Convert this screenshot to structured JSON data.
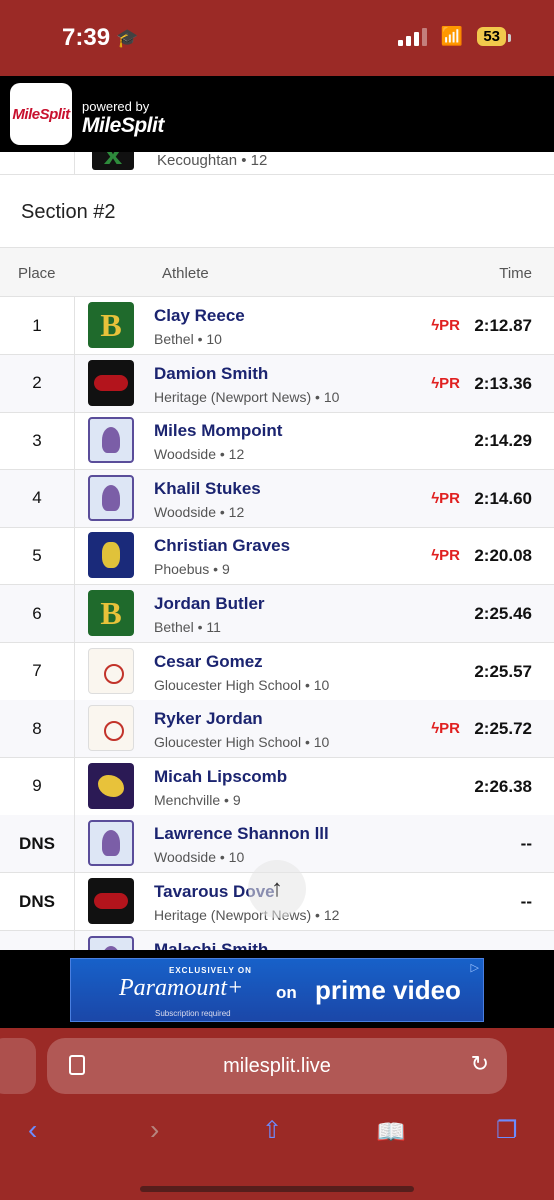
{
  "status_bar": {
    "time": "7:39",
    "battery": "53"
  },
  "app_header": {
    "logo_text": "MileSplit",
    "powered_by": "powered by",
    "brand": "MileSplit"
  },
  "previous_row": {
    "school_year": "Kecoughtan • 12"
  },
  "section_title": "Section #2",
  "table": {
    "headers": {
      "place": "Place",
      "athlete": "Athlete",
      "time": "Time"
    },
    "rows": [
      {
        "place": "1",
        "name": "Clay Reece",
        "school": "Bethel • 10",
        "pr": "PR",
        "time": "2:12.87",
        "logo": "bethel"
      },
      {
        "place": "2",
        "name": "Damion Smith",
        "school": "Heritage (Newport News) • 10",
        "pr": "PR",
        "time": "2:13.36",
        "logo": "heritage"
      },
      {
        "place": "3",
        "name": "Miles Mompoint",
        "school": "Woodside • 12",
        "pr": "",
        "time": "2:14.29",
        "logo": "woodside"
      },
      {
        "place": "4",
        "name": "Khalil Stukes",
        "school": "Woodside • 12",
        "pr": "PR",
        "time": "2:14.60",
        "logo": "woodside"
      },
      {
        "place": "5",
        "name": "Christian Graves",
        "school": "Phoebus • 9",
        "pr": "PR",
        "time": "2:20.08",
        "logo": "phoebus"
      },
      {
        "place": "6",
        "name": "Jordan Butler",
        "school": "Bethel • 11",
        "pr": "",
        "time": "2:25.46",
        "logo": "bethel"
      },
      {
        "place": "7",
        "name": "Cesar Gomez",
        "school": "Gloucester High School • 10",
        "pr": "",
        "time": "2:25.57",
        "logo": "glouc"
      },
      {
        "place": "8",
        "name": "Ryker Jordan",
        "school": "Gloucester High School • 10",
        "pr": "PR",
        "time": "2:25.72",
        "logo": "glouc"
      },
      {
        "place": "9",
        "name": "Micah Lipscomb",
        "school": "Menchville • 9",
        "pr": "",
        "time": "2:26.38",
        "logo": "mench"
      },
      {
        "place": "DNS",
        "name": "Lawrence Shannon lll",
        "school": "Woodside • 10",
        "pr": "",
        "time": "--",
        "logo": "woodside"
      },
      {
        "place": "DNS",
        "name": "Tavarous Dove",
        "school": "Heritage (Newport News) • 12",
        "pr": "",
        "time": "--",
        "logo": "heritage"
      },
      {
        "place": "",
        "name": "Malachi Smith",
        "school": "",
        "pr": "",
        "time": "",
        "logo": "woodside"
      }
    ]
  },
  "ad": {
    "exclusive": "EXCLUSIVELY ON",
    "paramount": "Paramount+",
    "on": "on",
    "prime": "prime video",
    "subscription": "Subscription required"
  },
  "browser": {
    "url": "milesplit.live"
  },
  "colors": {
    "chrome": "#9b2a26",
    "name": "#1b2470",
    "pr": "#e02020"
  }
}
